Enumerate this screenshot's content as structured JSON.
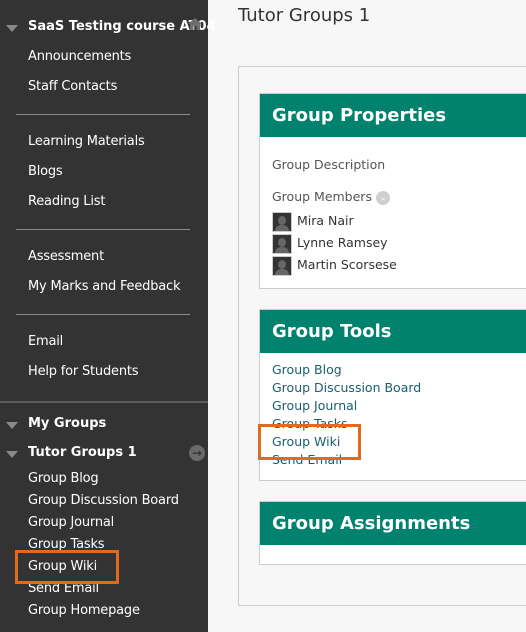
{
  "sidebar": {
    "course_title": "SaaS Testing course AT04",
    "sections": [
      [
        "Announcements",
        "Staff Contacts"
      ],
      [
        "Learning Materials",
        "Blogs",
        "Reading List"
      ],
      [
        "Assessment",
        "My Marks and Feedback"
      ],
      [
        "Email",
        "Help for Students"
      ]
    ],
    "my_groups_label": "My Groups",
    "group_title": "Tutor Groups 1",
    "group_items": [
      "Group Blog",
      "Group Discussion Board",
      "Group Journal",
      "Group Tasks",
      "Group Wiki",
      "Send Email",
      "Group Homepage"
    ],
    "icons": {
      "home": "home-icon",
      "expand": "triangle-down-icon",
      "go": "arrow-right-circle-icon"
    }
  },
  "main": {
    "page_title": "Tutor Groups 1",
    "group_properties": {
      "title": "Group Properties",
      "description_label": "Group Description",
      "members_label": "Group Members",
      "members": [
        "Mira Nair",
        "Lynne Ramsey",
        "Martin Scorsese"
      ]
    },
    "group_tools": {
      "title": "Group Tools",
      "links": [
        "Group Blog",
        "Group Discussion Board",
        "Group Journal",
        "Group Tasks",
        "Group Wiki",
        "Send Email"
      ]
    },
    "group_assignments": {
      "title": "Group Assignments"
    }
  },
  "colors": {
    "sidebar_bg": "#333333",
    "module_header": "#00826e",
    "highlight": "#e06a1f",
    "link": "#1b5e6e"
  }
}
